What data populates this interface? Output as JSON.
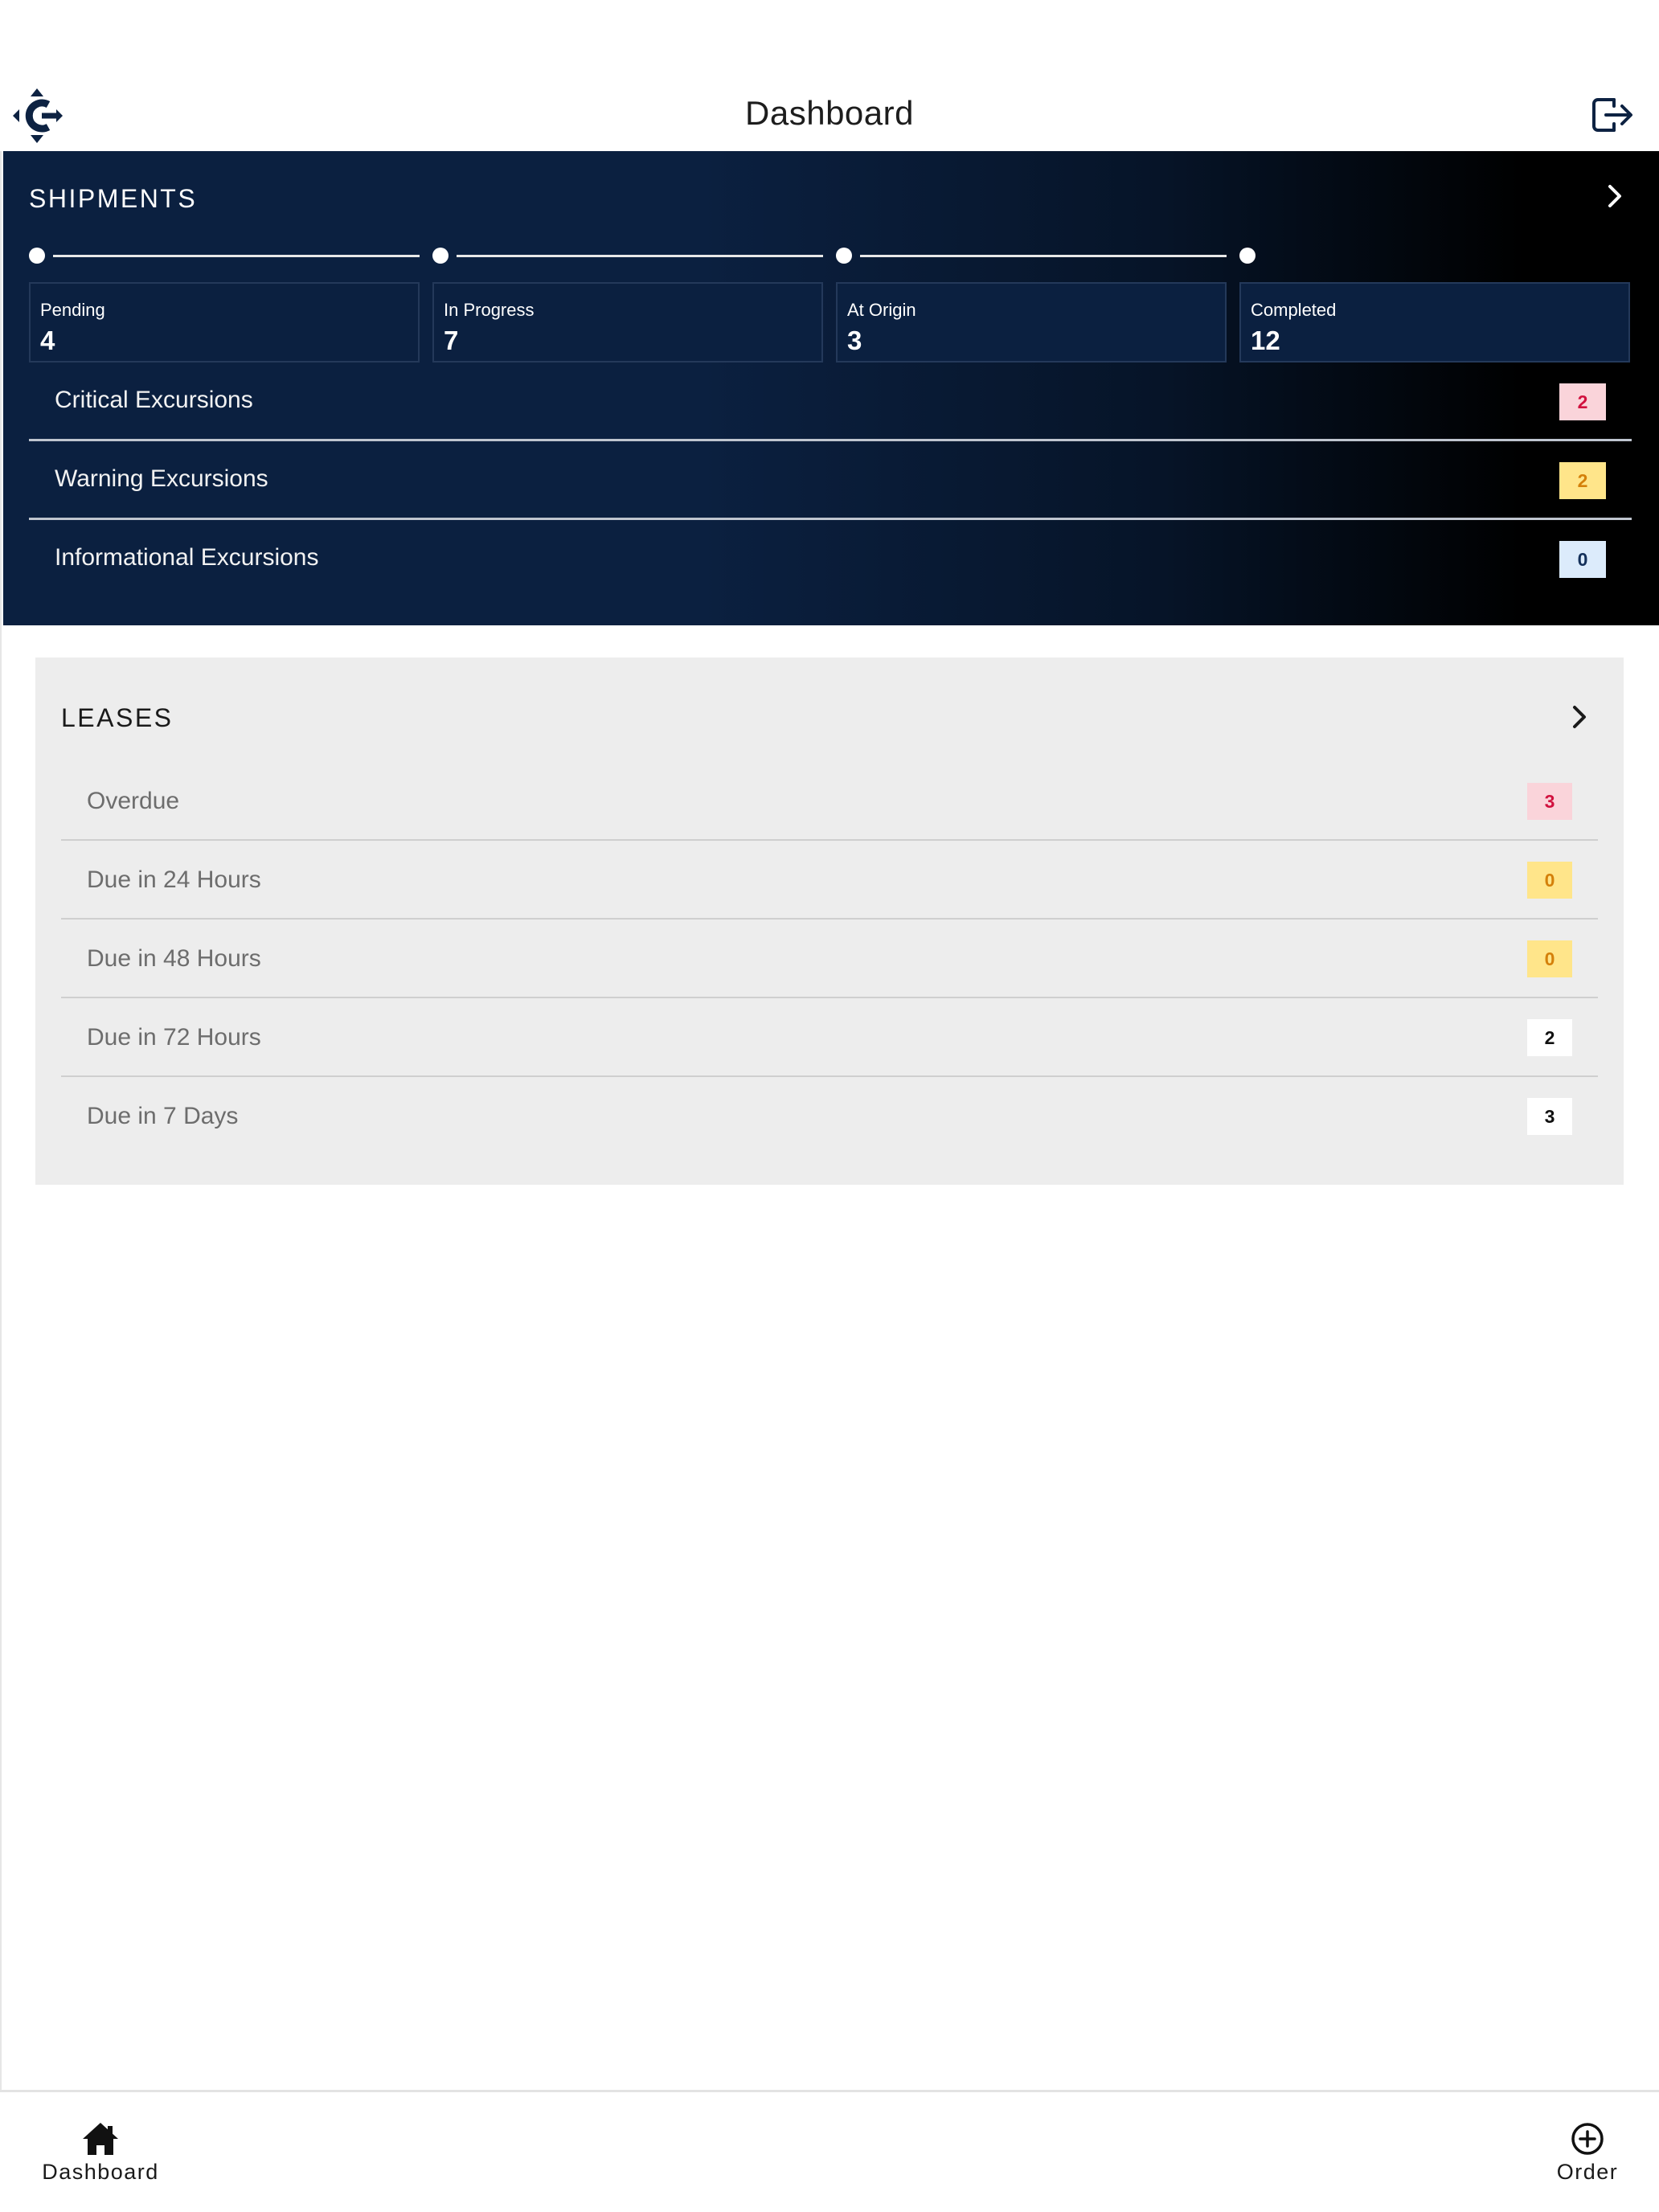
{
  "header": {
    "title": "Dashboard"
  },
  "shipments": {
    "title": "SHIPMENTS",
    "statuses": [
      {
        "label": "Pending",
        "value": "4"
      },
      {
        "label": "In Progress",
        "value": "7"
      },
      {
        "label": "At Origin",
        "value": "3"
      },
      {
        "label": "Completed",
        "value": "12"
      }
    ],
    "excursions": [
      {
        "label": "Critical Excursions",
        "count": "2",
        "badge_bg": "#fad4da",
        "badge_fg": "#d1123f"
      },
      {
        "label": "Warning Excursions",
        "count": "2",
        "badge_bg": "#ffe58a",
        "badge_fg": "#d4800a"
      },
      {
        "label": "Informational Excursions",
        "count": "0",
        "badge_bg": "#dcebfb",
        "badge_fg": "#14305a"
      }
    ]
  },
  "leases": {
    "title": "LEASES",
    "rows": [
      {
        "label": "Overdue",
        "count": "3",
        "badge_bg": "#fad4da",
        "badge_fg": "#d1123f"
      },
      {
        "label": "Due in 24 Hours",
        "count": "0",
        "badge_bg": "#ffe58a",
        "badge_fg": "#d4800a"
      },
      {
        "label": "Due in 48 Hours",
        "count": "0",
        "badge_bg": "#ffe58a",
        "badge_fg": "#d4800a"
      },
      {
        "label": "Due in 72 Hours",
        "count": "2",
        "badge_bg": "#ffffff",
        "badge_fg": "#111111"
      },
      {
        "label": "Due in 7 Days",
        "count": "3",
        "badge_bg": "#ffffff",
        "badge_fg": "#111111"
      }
    ]
  },
  "bottom_nav": {
    "items": [
      {
        "label": "Dashboard",
        "icon": "home-icon"
      },
      {
        "label": "Order",
        "icon": "add-circle-icon"
      }
    ]
  },
  "colors": {
    "brand_navy": "#0b2040",
    "panel_gray": "#ededed"
  }
}
